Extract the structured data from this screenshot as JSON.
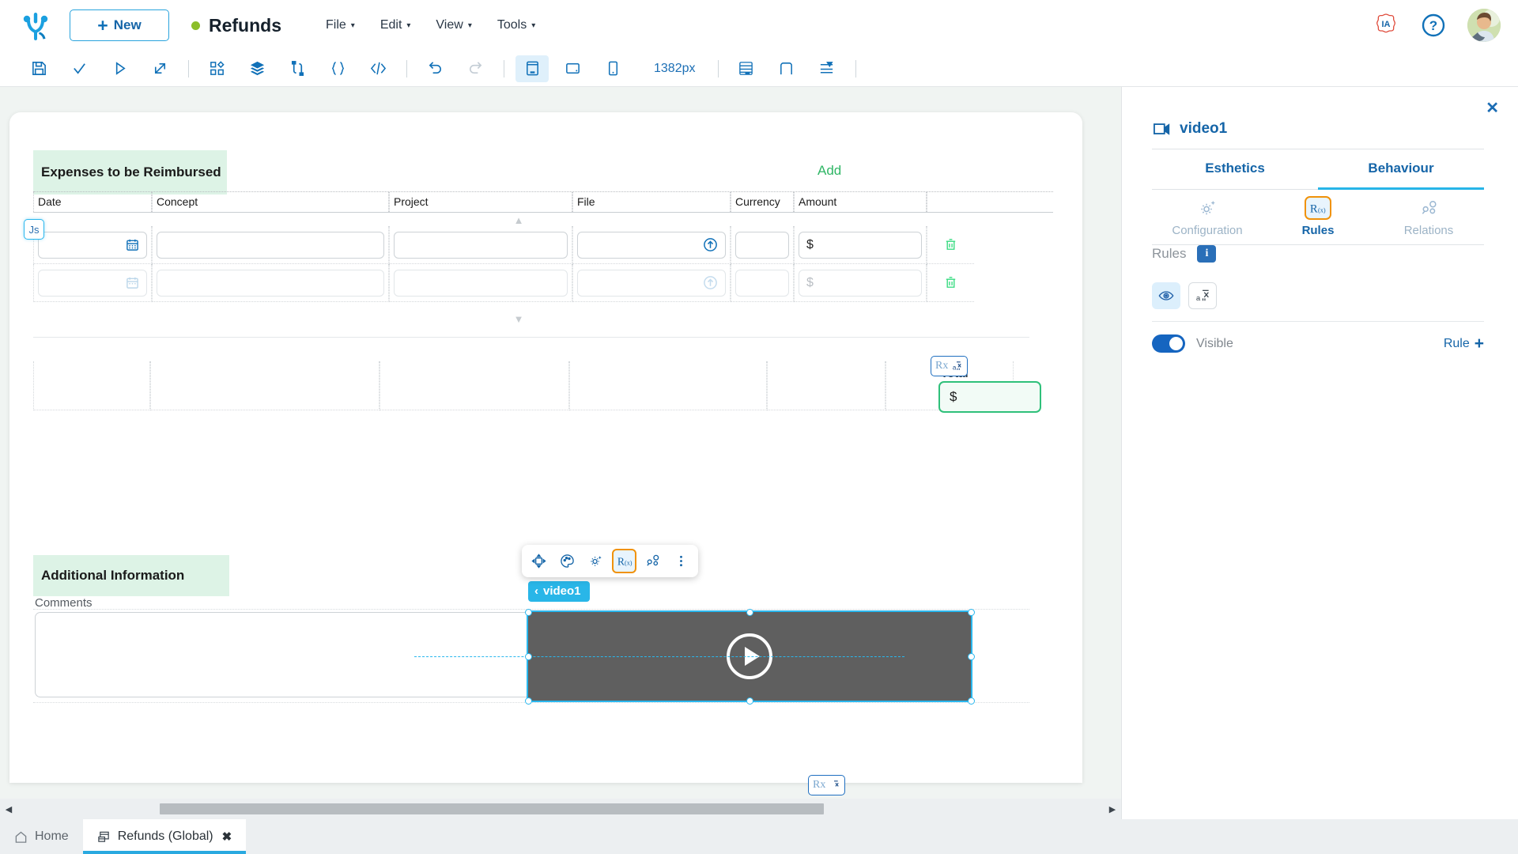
{
  "topbar": {
    "logo_icon": "brand-logo-icon",
    "new_button": {
      "label": "New",
      "plus": "+"
    },
    "app_title": "Refunds",
    "status_dot_color": "#8cbe2a",
    "menus": [
      {
        "label": "File",
        "caret": "▾"
      },
      {
        "label": "Edit",
        "caret": "▾"
      },
      {
        "label": "View",
        "caret": "▾"
      },
      {
        "label": "Tools",
        "caret": "▾"
      }
    ],
    "right_icons": [
      {
        "name": "ia-assistant-icon",
        "label": "IA"
      },
      {
        "name": "help-icon",
        "label": "?"
      },
      {
        "name": "user-avatar",
        "label": ""
      }
    ]
  },
  "toolbar": {
    "buttons": [
      {
        "name": "save-icon"
      },
      {
        "name": "validate-check-icon"
      },
      {
        "name": "run-play-icon"
      },
      {
        "name": "deploy-export-icon"
      },
      {
        "name": "components-grid-icon"
      },
      {
        "name": "layers-icon"
      },
      {
        "name": "data-model-icon"
      },
      {
        "name": "braces-icon"
      },
      {
        "name": "code-icon"
      },
      {
        "name": "undo-icon"
      },
      {
        "name": "redo-icon"
      },
      {
        "name": "desktop-view-icon"
      },
      {
        "name": "tablet-view-icon"
      },
      {
        "name": "mobile-view-icon"
      },
      {
        "name": "grid-layout-icon"
      },
      {
        "name": "container-icon"
      },
      {
        "name": "align-icon"
      }
    ],
    "width_label": "1382px",
    "active_view": "desktop-view-icon"
  },
  "canvas": {
    "sections": [
      {
        "title": "Expenses to be Reimbursed"
      },
      {
        "title": "Additional Information"
      }
    ],
    "add_link": "Add",
    "js_badge": "Js",
    "rx_badge": {
      "label": "Rx",
      "icon": "rx-formula-icon"
    },
    "expenses_table": {
      "columns": [
        "Date",
        "Concept",
        "Project",
        "File",
        "Currency",
        "Amount"
      ],
      "rows": [
        {
          "date": "",
          "concept": "",
          "project": "",
          "file": "",
          "currency": "",
          "amount": "$",
          "state": "active",
          "date_icon": "calendar-icon",
          "file_icon": "upload-icon",
          "delete_icon": "trash-icon"
        },
        {
          "date": "",
          "concept": "",
          "project": "",
          "file": "",
          "currency": "",
          "amount": "$",
          "state": "muted",
          "date_icon": "calendar-icon",
          "file_icon": "upload-icon",
          "delete_icon": "trash-icon"
        }
      ]
    },
    "total": {
      "label": "Total",
      "value": "$"
    },
    "comments": {
      "label": "Comments",
      "value": ""
    },
    "video": {
      "tag_label": "video1",
      "tag_chevron": "‹",
      "play_icon": "play-icon",
      "background_color": "#5f5f5f"
    },
    "float_toolbar": [
      {
        "name": "move-icon",
        "selected": false
      },
      {
        "name": "palette-icon",
        "selected": false
      },
      {
        "name": "settings-gear-icon",
        "selected": false
      },
      {
        "name": "rules-rx-icon",
        "selected": true
      },
      {
        "name": "relations-icon",
        "selected": false
      },
      {
        "name": "more-vertical-icon",
        "selected": false
      }
    ]
  },
  "right_panel": {
    "close_icon": "close-icon",
    "title": "video1",
    "title_icon": "video-icon",
    "tabs": [
      {
        "label": "Esthetics",
        "active": false
      },
      {
        "label": "Behaviour",
        "active": true
      }
    ],
    "subtabs": [
      {
        "label": "Configuration",
        "icon": "settings-gear-icon",
        "active": false
      },
      {
        "label": "Rules",
        "icon": "rules-rx-icon",
        "active": true
      },
      {
        "label": "Relations",
        "icon": "relations-icon",
        "active": false
      }
    ],
    "rules_label": "Rules",
    "info_badge": "i",
    "rule_icons": [
      {
        "name": "eye-visibility-icon",
        "active": true
      },
      {
        "name": "value-formula-icon",
        "active": false
      }
    ],
    "visible_toggle": {
      "label": "Visible",
      "on": true
    },
    "rule_add": {
      "label": "Rule",
      "plus": "+"
    }
  },
  "bottom": {
    "scroll_left_arrow": "◀",
    "scroll_right_arrow": "▶",
    "tabs": [
      {
        "label": "Home",
        "icon": "home-icon",
        "active": false,
        "closable": false
      },
      {
        "label": "Refunds (Global)",
        "icon": "form-icon",
        "active": true,
        "closable": true,
        "close": "✖"
      }
    ]
  },
  "colors": {
    "accent_blue": "#1565a8",
    "cyan": "#27b5e8",
    "green": "#2fb665",
    "orange": "#f0920a",
    "section_bg": "#ddf3e6"
  }
}
